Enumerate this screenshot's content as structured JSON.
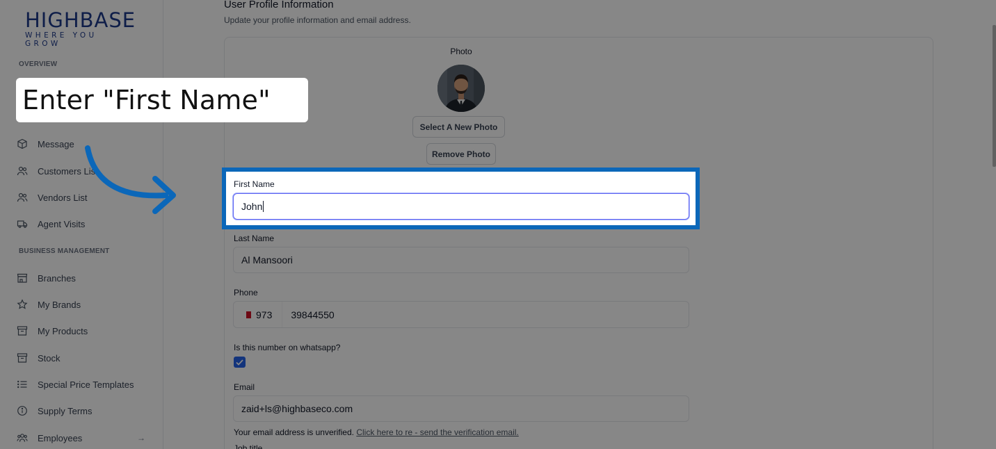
{
  "logo": {
    "main": "HIGHBASE",
    "sub": "WHERE YOU GROW"
  },
  "sidebar": {
    "overview_title": "OVERVIEW",
    "business_title": "BUSINESS MANAGEMENT",
    "items": [
      {
        "label": "Message",
        "icon": "cube-icon"
      },
      {
        "label": "Customers List",
        "icon": "users-icon"
      },
      {
        "label": "Vendors List",
        "icon": "users-icon"
      },
      {
        "label": "Agent Visits",
        "icon": "truck-icon"
      },
      {
        "label": "Branches",
        "icon": "store-icon"
      },
      {
        "label": "My Brands",
        "icon": "star-icon"
      },
      {
        "label": "My Products",
        "icon": "archive-icon"
      },
      {
        "label": "Stock",
        "icon": "archive-icon"
      },
      {
        "label": "Special Price Templates",
        "icon": "list-icon"
      },
      {
        "label": "Supply Terms",
        "icon": "info-icon"
      },
      {
        "label": "Employees",
        "icon": "team-icon",
        "chevron": "→"
      }
    ]
  },
  "header": {
    "title": "User Profile Information",
    "subtitle": "Update your profile information and email address."
  },
  "photo": {
    "label": "Photo",
    "select_button": "Select A New Photo",
    "remove_button": "Remove Photo"
  },
  "form": {
    "first_name": {
      "label": "First Name",
      "value": "John"
    },
    "last_name": {
      "label": "Last Name",
      "value": "Al Mansoori"
    },
    "phone": {
      "label": "Phone",
      "code": "973",
      "value": "39844550"
    },
    "whatsapp": {
      "label": "Is this number on whatsapp?",
      "checked": true
    },
    "email": {
      "label": "Email",
      "value": "zaid+ls@highbaseco.com"
    },
    "unverified_note": "Your email address is unverified.",
    "resend_link": "Click here to re - send the verification email.",
    "job_title_label": "Job title"
  },
  "overlay": {
    "instruction": "Enter \"First Name\"",
    "highlight_color": "#0b67b9"
  },
  "colors": {
    "brand": "#1e3a8a",
    "accent": "#2563eb",
    "focus": "#6366f1"
  }
}
